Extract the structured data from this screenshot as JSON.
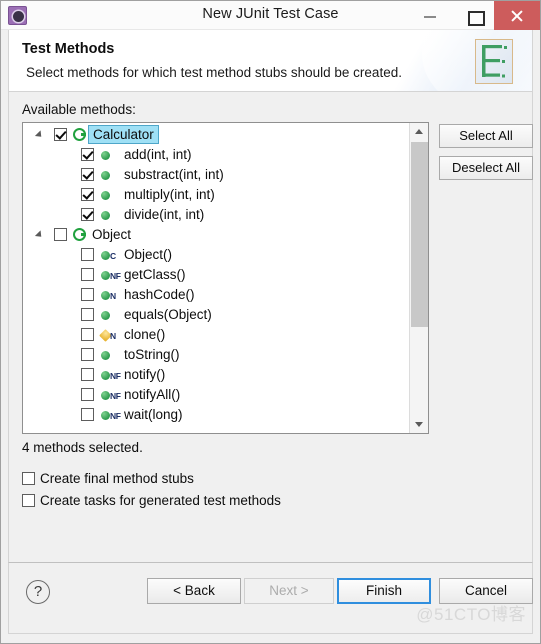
{
  "window": {
    "title": "New JUnit Test Case",
    "app_icon": "eclipse-icon",
    "minimize_label": "Minimize",
    "maximize_label": "Maximize",
    "close_label": "Close"
  },
  "banner": {
    "title": "Test Methods",
    "description": "Select methods for which test method stubs should be created.",
    "icon": "junit-wizard-icon"
  },
  "main": {
    "available_label": "Available methods:",
    "status": "4 methods selected.",
    "select_all_label": "Select All",
    "deselect_all_label": "Deselect All"
  },
  "tree": [
    {
      "label": "Calculator",
      "level": 1,
      "kind": "class",
      "checked": true,
      "selected": true,
      "expanded": true,
      "badge": ""
    },
    {
      "label": "add(int, int)",
      "level": 2,
      "kind": "method",
      "checked": true,
      "selected": false,
      "expanded": false,
      "badge": ""
    },
    {
      "label": "substract(int, int)",
      "level": 2,
      "kind": "method",
      "checked": true,
      "selected": false,
      "expanded": false,
      "badge": ""
    },
    {
      "label": "multiply(int, int)",
      "level": 2,
      "kind": "method",
      "checked": true,
      "selected": false,
      "expanded": false,
      "badge": ""
    },
    {
      "label": "divide(int, int)",
      "level": 2,
      "kind": "method",
      "checked": true,
      "selected": false,
      "expanded": false,
      "badge": ""
    },
    {
      "label": "Object",
      "level": 1,
      "kind": "class",
      "checked": false,
      "selected": false,
      "expanded": true,
      "badge": ""
    },
    {
      "label": "Object()",
      "level": 2,
      "kind": "method",
      "checked": false,
      "selected": false,
      "expanded": false,
      "badge": "C"
    },
    {
      "label": "getClass()",
      "level": 2,
      "kind": "method",
      "checked": false,
      "selected": false,
      "expanded": false,
      "badge": "NF"
    },
    {
      "label": "hashCode()",
      "level": 2,
      "kind": "method",
      "checked": false,
      "selected": false,
      "expanded": false,
      "badge": "N"
    },
    {
      "label": "equals(Object)",
      "level": 2,
      "kind": "method",
      "checked": false,
      "selected": false,
      "expanded": false,
      "badge": ""
    },
    {
      "label": "clone()",
      "level": 2,
      "kind": "diamond",
      "checked": false,
      "selected": false,
      "expanded": false,
      "badge": "N"
    },
    {
      "label": "toString()",
      "level": 2,
      "kind": "method",
      "checked": false,
      "selected": false,
      "expanded": false,
      "badge": ""
    },
    {
      "label": "notify()",
      "level": 2,
      "kind": "method",
      "checked": false,
      "selected": false,
      "expanded": false,
      "badge": "NF"
    },
    {
      "label": "notifyAll()",
      "level": 2,
      "kind": "method",
      "checked": false,
      "selected": false,
      "expanded": false,
      "badge": "NF"
    },
    {
      "label": "wait(long)",
      "level": 2,
      "kind": "method",
      "checked": false,
      "selected": false,
      "expanded": false,
      "badge": "NF"
    }
  ],
  "options": [
    {
      "label": "Create final method stubs",
      "checked": false
    },
    {
      "label": "Create tasks for generated test methods",
      "checked": false
    }
  ],
  "footer": {
    "help_label": "?",
    "back_label": "< Back",
    "next_label": "Next >",
    "finish_label": "Finish",
    "cancel_label": "Cancel"
  },
  "watermark": "@51CTO博客",
  "colors": {
    "accent_green": "#21a13f",
    "selection_blue": "#9fe0f5",
    "focus_blue": "#2f8ede",
    "close_red": "#cd5c5c"
  }
}
